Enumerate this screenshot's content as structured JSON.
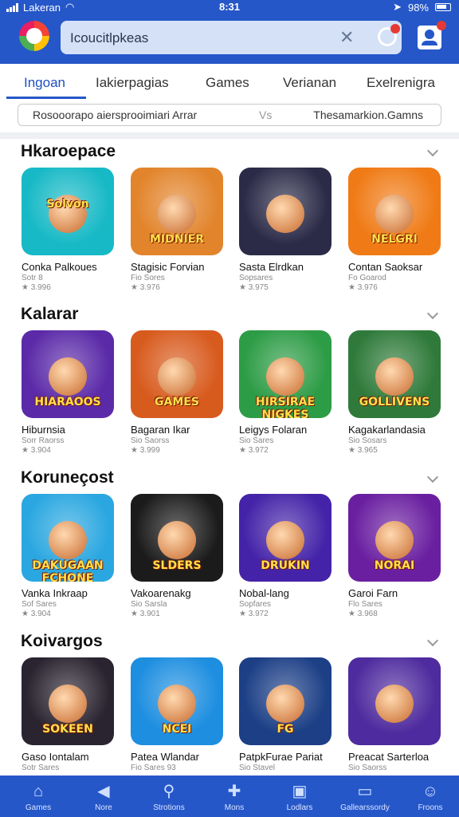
{
  "status_bar": {
    "carrier": "Lakeran",
    "time": "8:31",
    "battery": "98%"
  },
  "search": {
    "value": "Icoucitlpkeas"
  },
  "tabs": [
    {
      "label": "Ingoan",
      "active": true
    },
    {
      "label": "Iakierpagias",
      "active": false
    },
    {
      "label": "Games",
      "active": false
    },
    {
      "label": "Verianan",
      "active": false
    },
    {
      "label": "Exelrenigra",
      "active": false
    }
  ],
  "filter": {
    "left": "Rosooorapo aiersprooimiari Arrar",
    "middle": "Vs",
    "right": "Thesamarkion.Gamns"
  },
  "sections": [
    {
      "title": "Hkaroepace",
      "apps": [
        {
          "name": "Conka Palkoues",
          "sub": "Sotr 8",
          "rating": "★ 3.996",
          "icon_text": "Solvon",
          "bg": "#17b9c6"
        },
        {
          "name": "Stagisic Forvian",
          "sub": "Fio Sores",
          "rating": "★ 3.976",
          "icon_text": "MIDNIER",
          "bg": "#e2842b"
        },
        {
          "name": "Sasta Elrdkan",
          "sub": "Sopsares",
          "rating": "★ 3.975",
          "icon_text": "",
          "bg": "#2b2b48"
        },
        {
          "name": "Contan Saoksar",
          "sub": "Fo Goarod",
          "rating": "★ 3.976",
          "icon_text": "NELGRI",
          "bg": "#f07b16"
        }
      ]
    },
    {
      "title": "Kalarar",
      "apps": [
        {
          "name": "Hiburnsia",
          "sub": "Sorr Raorss",
          "rating": "★ 3.904",
          "icon_text": "HIARAOOS",
          "bg": "#5b2aa8"
        },
        {
          "name": "Bagaran Ikar",
          "sub": "Sio Saorss",
          "rating": "★ 3.999",
          "icon_text": "GAMES",
          "bg": "#d85b1e"
        },
        {
          "name": "Leigys Folaran",
          "sub": "Sio Sares",
          "rating": "★ 3.972",
          "icon_text": "HIRSIRAE NIGKES",
          "bg": "#2d9c46"
        },
        {
          "name": "Kagakarlandasia",
          "sub": "Sio Sosars",
          "rating": "★ 3.965",
          "icon_text": "GOLLIVENS",
          "bg": "#2f7a3a"
        }
      ]
    },
    {
      "title": "Koruneçost",
      "apps": [
        {
          "name": "Vanka Inkraap",
          "sub": "Sof Sares",
          "rating": "★ 3.904",
          "icon_text": "DAKUGAAN FCHONE",
          "bg": "#2aa7e0"
        },
        {
          "name": "Vakoarenakg",
          "sub": "Sio Sarsla",
          "rating": "★ 3.901",
          "icon_text": "SLDERS",
          "bg": "#1b1b1b"
        },
        {
          "name": "Nobal-lang",
          "sub": "Sopfares",
          "rating": "★ 3.972",
          "icon_text": "DRUKIN",
          "bg": "#4423a8"
        },
        {
          "name": "Garoi Farn",
          "sub": "Flo Sares",
          "rating": "★ 3.968",
          "icon_text": "NORAI",
          "bg": "#6a1fa0"
        }
      ]
    },
    {
      "title": "Koivargos",
      "apps": [
        {
          "name": "Gaso Iontalam",
          "sub": "Sotr Sares",
          "rating": "",
          "icon_text": "SOKEEN",
          "bg": "#2a2430"
        },
        {
          "name": "Patea Wlandar",
          "sub": "Fio Sares 93",
          "rating": "",
          "icon_text": "NCEI",
          "bg": "#1d8ee0"
        },
        {
          "name": "PatpkFurae Pariat",
          "sub": "Sio Stavel",
          "rating": "",
          "icon_text": "FG",
          "bg": "#1c3f86"
        },
        {
          "name": "Preacat Sarterloa",
          "sub": "Sio Saorss",
          "rating": "",
          "icon_text": "",
          "bg": "#4e2b9e"
        }
      ]
    }
  ],
  "bottom_nav": [
    {
      "label": "Games",
      "icon": "home-icon"
    },
    {
      "label": "Nore",
      "icon": "back-icon"
    },
    {
      "label": "Strotions",
      "icon": "search-icon"
    },
    {
      "label": "Mons",
      "icon": "game-icon"
    },
    {
      "label": "Lodlars",
      "icon": "library-icon"
    },
    {
      "label": "Gallearssordy",
      "icon": "folder-icon"
    },
    {
      "label": "Froons",
      "icon": "profile-icon"
    }
  ],
  "colors": {
    "primary": "#2557c9",
    "accent_tab": "#1d4fc2",
    "badge": "#e53935"
  }
}
